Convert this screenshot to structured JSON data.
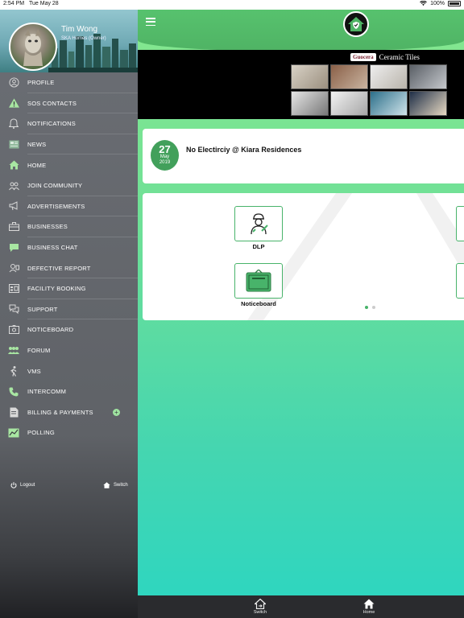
{
  "status_bar": {
    "time": "2:54 PM",
    "date": "Tue May 28",
    "battery": "100%"
  },
  "profile": {
    "name": "Tim Wong",
    "role": "SKA Homes  (Owner)"
  },
  "menu": [
    {
      "label": "PROFILE",
      "icon": "user-circle-icon"
    },
    {
      "label": "SOS CONTACTS",
      "icon": "warning-icon"
    },
    {
      "label": "NOTIFICATIONS",
      "icon": "bell-icon"
    },
    {
      "label": "NEWS",
      "icon": "newspaper-icon"
    },
    {
      "label": "HOME",
      "icon": "home-icon"
    },
    {
      "label": "JOIN COMMUNITY",
      "icon": "community-icon"
    },
    {
      "label": "ADVERTISEMENTS",
      "icon": "megaphone-icon"
    },
    {
      "label": "BUSINESSES",
      "icon": "briefcase-icon"
    },
    {
      "label": "BUSINESS CHAT",
      "icon": "chat-icon"
    },
    {
      "label": "DEFECTIVE REPORT",
      "icon": "report-icon"
    },
    {
      "label": "FACILITY BOOKING",
      "icon": "booking-icon"
    },
    {
      "label": "SUPPORT",
      "icon": "support-icon"
    },
    {
      "label": "NOTICEBOARD",
      "icon": "noticeboard-icon"
    },
    {
      "label": "FORUM",
      "icon": "forum-icon"
    },
    {
      "label": "VMS",
      "icon": "walker-icon"
    },
    {
      "label": "INTERCOMM",
      "icon": "phone-icon"
    },
    {
      "label": "BILLING & PAYMENTS",
      "icon": "bill-icon"
    },
    {
      "label": "POLLING",
      "icon": "poll-icon"
    }
  ],
  "footer": {
    "logout": "Logout",
    "switch": "Switch"
  },
  "banner": {
    "brand": "Guocera",
    "text": "Ceramic Tiles"
  },
  "news": {
    "day": "27",
    "month": "May",
    "year": "2019",
    "title": "No Electirciy @ Kiara Residences"
  },
  "tiles": [
    {
      "label": "DLP",
      "icon": "technician-icon"
    },
    {
      "label": "Noticeboard",
      "icon": "board-icon"
    }
  ],
  "tabbar": {
    "switch": "Switch",
    "home": "Home"
  },
  "colors": {
    "accent": "#4fb364",
    "drawer": "#5f6267"
  }
}
